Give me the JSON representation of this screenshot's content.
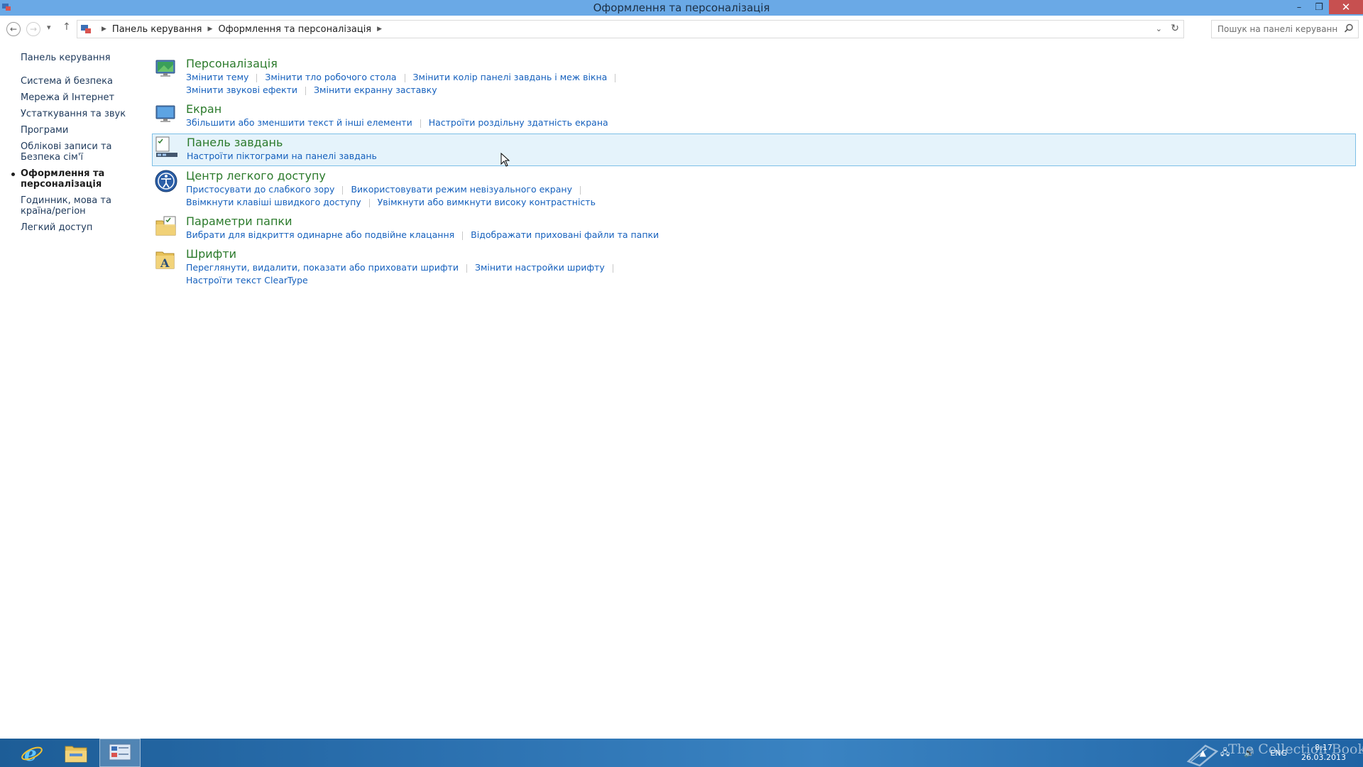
{
  "window": {
    "title": "Оформлення та персоналізація",
    "minimize": "–",
    "restore": "❐",
    "close": "✕"
  },
  "toolbar": {
    "back": "←",
    "forward": "→",
    "recent": "▾",
    "up": "↑",
    "breadcrumb": [
      "Панель керування",
      "Оформлення та персоналізація"
    ],
    "search_placeholder": "Пошук на панелі керування"
  },
  "sidebar": {
    "home": "Панель керування",
    "items": [
      {
        "label": "Система й безпека",
        "active": false
      },
      {
        "label": "Мережа й Інтернет",
        "active": false
      },
      {
        "label": "Устаткування та звук",
        "active": false
      },
      {
        "label": "Програми",
        "active": false
      },
      {
        "label": "Облікові записи та Безпека сім'ї",
        "active": false
      },
      {
        "label": "Оформлення та персоналізація",
        "active": true
      },
      {
        "label": "Годинник, мова та країна/регіон",
        "active": false
      },
      {
        "label": "Легкий доступ",
        "active": false
      }
    ]
  },
  "categories": [
    {
      "title": "Персоналізація",
      "icon": "personalization-icon",
      "links": [
        [
          "Змінити тему",
          "Змінити тло робочого стола",
          "Змінити колір панелі завдань і меж вікна"
        ],
        [
          "Змінити звукові ефекти",
          "Змінити екранну заставку"
        ]
      ]
    },
    {
      "title": "Екран",
      "icon": "display-icon",
      "links": [
        [
          "Збільшити або зменшити текст й інші елементи",
          "Настроїти роздільну здатність екрана"
        ]
      ]
    },
    {
      "title": "Панель завдань",
      "icon": "taskbar-icon",
      "hover": true,
      "links": [
        [
          "Настроїти піктограми на панелі завдань"
        ]
      ]
    },
    {
      "title": "Центр легкого доступу",
      "icon": "ease-of-access-icon",
      "links": [
        [
          "Пристосувати до слабкого зору",
          "Використовувати режим невізуального екрану"
        ],
        [
          "Ввімкнути клавіші швидкого доступу",
          "Увімкнути або вимкнути високу контрастність"
        ]
      ]
    },
    {
      "title": "Параметри папки",
      "icon": "folder-options-icon",
      "links": [
        [
          "Вибрати для відкриття одинарне або подвійне клацання",
          "Відображати приховані файли та папки"
        ]
      ]
    },
    {
      "title": "Шрифти",
      "icon": "fonts-icon",
      "links": [
        [
          "Переглянути, видалити, показати або приховати шрифти",
          "Змінити настройки шрифту"
        ],
        [
          "Настроїти текст ClearType"
        ]
      ]
    }
  ],
  "taskbar": {
    "apps": [
      "internet-explorer-icon",
      "file-explorer-icon",
      "control-panel-icon"
    ],
    "active_app": "control-panel-icon",
    "language": "ENG",
    "time": "8:17",
    "date": "26.03.2013",
    "watermark": "The Collection Book"
  },
  "colors": {
    "titlebar": "#6aa9e6",
    "category_title": "#2b7a2b",
    "link": "#1560bd",
    "hover_bg": "#e5f3fb",
    "hover_border": "#7dbfe6",
    "taskbar": "#2a6fae"
  }
}
